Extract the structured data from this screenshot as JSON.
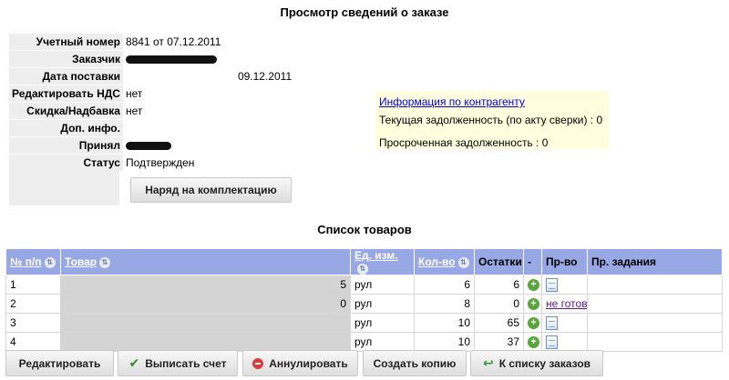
{
  "page_title": "Просмотр сведений о заказе",
  "order": {
    "fields": [
      {
        "label": "Учетный номер",
        "value": "8841 от 07.12.2011"
      },
      {
        "label": "Заказчик",
        "value": ""
      },
      {
        "label": "Дата поставки",
        "value": "09.12.2011"
      },
      {
        "label": "Редактировать НДС",
        "value": "нет"
      },
      {
        "label": "Скидка/Надбавка",
        "value": "нет"
      },
      {
        "label": "Доп. инфо.",
        "value": ""
      },
      {
        "label": "Принял",
        "value": ""
      },
      {
        "label": "Статус",
        "value": "Подтвержден"
      }
    ],
    "assembly_button": "Наряд на комплектацию"
  },
  "contractor": {
    "link": "Информация по контрагенту",
    "debt": "Текущая задолженность (по акту сверки) : 0",
    "overdue": "Просроченная задолженность : 0"
  },
  "goods": {
    "title": "Список товаров",
    "columns": [
      "№ п/п",
      "Товар",
      "Ед. изм.",
      "Кол-во",
      "Остатки",
      "-",
      "Пр-во",
      "Пр. задания"
    ],
    "rows": [
      {
        "n": "1",
        "product_suffix": "5",
        "unit": "рул",
        "qty": "6",
        "stock": "6",
        "prod": ""
      },
      {
        "n": "2",
        "product_suffix": "0",
        "unit": "рул",
        "qty": "8",
        "stock": "0",
        "prod": "не готов"
      },
      {
        "n": "3",
        "product_suffix": "",
        "unit": "рул",
        "qty": "10",
        "stock": "65",
        "prod": ""
      },
      {
        "n": "4",
        "product_suffix": "",
        "unit": "рул",
        "qty": "10",
        "stock": "37",
        "prod": ""
      }
    ]
  },
  "actions": {
    "edit": "Редактировать",
    "invoice": "Выписать счет",
    "cancel": "Аннулировать",
    "copy": "Создать копию",
    "back": "К списку заказов"
  },
  "colors": {
    "header_bg": "#98a8e4",
    "info_bg": "#ffffe0",
    "label_bg": "#eeeeee"
  },
  "icons": {
    "sort": "sort-arrows-icon",
    "add": "plus-circle-icon",
    "doc": "document-icon",
    "check": "check-icon",
    "cancel": "cancel-icon",
    "back": "back-arrow-icon"
  }
}
